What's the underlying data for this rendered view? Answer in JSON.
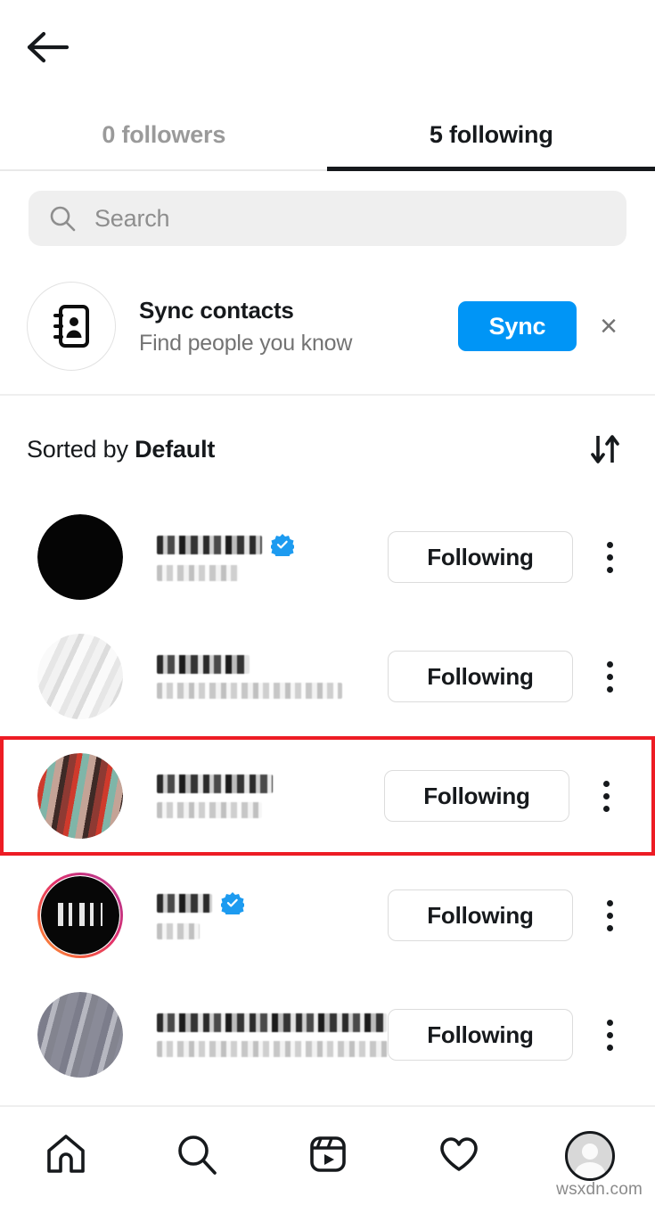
{
  "header": {
    "back_icon": "arrow-left-icon"
  },
  "tabs": [
    {
      "label": "0 followers",
      "active": false
    },
    {
      "label": "5 following",
      "active": true
    }
  ],
  "search": {
    "placeholder": "Search",
    "value": "",
    "icon": "search-icon"
  },
  "sync_contacts": {
    "icon": "contacts-book-icon",
    "title": "Sync contacts",
    "subtitle": "Find people you know",
    "button_label": "Sync",
    "close_label": "×",
    "button_color": "#0095f6"
  },
  "sort": {
    "prefix": "Sorted by ",
    "value": "Default",
    "icon": "sort-arrows-icon"
  },
  "users": [
    {
      "avatar_style": "av-black",
      "has_ring": false,
      "verified": true,
      "name_width": 118,
      "sub_width": 92,
      "action_label": "Following",
      "menu_icon": "more-options-icon",
      "highlighted": false
    },
    {
      "avatar_style": "av-white",
      "has_ring": false,
      "verified": false,
      "name_width": 104,
      "sub_width": 208,
      "action_label": "Following",
      "menu_icon": "more-options-icon",
      "highlighted": false
    },
    {
      "avatar_style": "av-red",
      "has_ring": false,
      "verified": false,
      "name_width": 130,
      "sub_width": 118,
      "action_label": "Following",
      "menu_icon": "more-options-icon",
      "highlighted": true
    },
    {
      "avatar_style": "av-dark-ring",
      "has_ring": true,
      "verified": true,
      "name_width": 62,
      "sub_width": 48,
      "action_label": "Following",
      "menu_icon": "more-options-icon",
      "highlighted": false
    },
    {
      "avatar_style": "av-gray",
      "has_ring": false,
      "verified": false,
      "name_width": 258,
      "sub_width": 262,
      "action_label": "Following",
      "menu_icon": "more-options-icon",
      "highlighted": false
    }
  ],
  "highlight": {
    "color": "#ed1c24",
    "row_index": 2
  },
  "bottom_nav": [
    {
      "icon": "home-icon",
      "active": false
    },
    {
      "icon": "search-icon",
      "active": false
    },
    {
      "icon": "reels-icon",
      "active": false
    },
    {
      "icon": "heart-icon",
      "active": false
    },
    {
      "icon": "profile-avatar-icon",
      "active": false
    }
  ],
  "watermark": {
    "text": "wsxdn.com"
  }
}
